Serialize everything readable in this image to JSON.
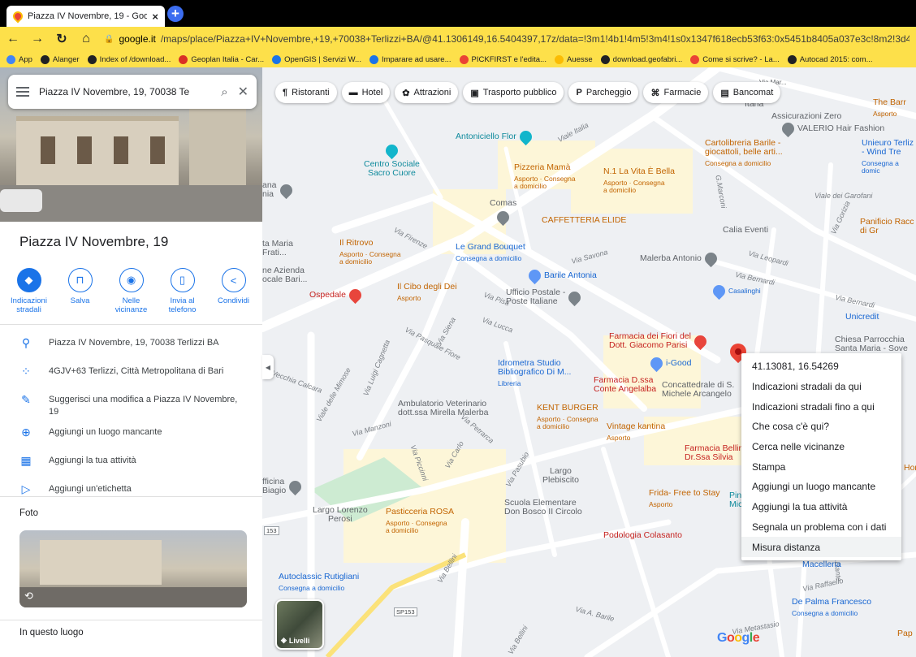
{
  "browser": {
    "tab_title": "Piazza IV Novembre, 19 - Google",
    "tab_close": "×",
    "new_tab": "+",
    "url_host": "google.it",
    "url_rest": "/maps/place/Piazza+IV+Novembre,+19,+70038+Terlizzi+BA/@41.1306149,16.5404397,17z/data=!3m1!4b1!4m5!3m4!1s0x1347f618ecb53f63:0x5451b8405a037e3c!8m2!3d41.1306109!4d16.5426284",
    "bookmarks": [
      {
        "label": "App",
        "color": "#4285f4"
      },
      {
        "label": "Alanger",
        "color": "#202124"
      },
      {
        "label": "Index of /download...",
        "color": "#202124"
      },
      {
        "label": "Geoplan Italia - Car...",
        "color": "#d93025"
      },
      {
        "label": "OpenGIS | Servizi W...",
        "color": "#1a73e8"
      },
      {
        "label": "Imparare ad usare...",
        "color": "#1a73e8"
      },
      {
        "label": "PICKFIRST e l'edita...",
        "color": "#ea4335"
      },
      {
        "label": "Auesse",
        "color": "#fbbc04"
      },
      {
        "label": "download.geofabri...",
        "color": "#202124"
      },
      {
        "label": "Come si scrive? - La...",
        "color": "#ea4335"
      },
      {
        "label": "Autocad 2015: com...",
        "color": "#202124"
      }
    ]
  },
  "panel": {
    "search_value": "Piazza IV Novembre, 19, 70038 Te",
    "place_name": "Piazza IV Novembre, 19",
    "actions": [
      {
        "label": "Indicazioni stradali",
        "icon": "◆"
      },
      {
        "label": "Salva",
        "icon": "⊓"
      },
      {
        "label": "Nelle vicinanze",
        "icon": "◉"
      },
      {
        "label": "Invia al telefono",
        "icon": "▯"
      },
      {
        "label": "Condividi",
        "icon": "<"
      }
    ],
    "info": [
      {
        "icon": "⚲",
        "text": "Piazza IV Novembre, 19, 70038 Terlizzi BA"
      },
      {
        "icon": "⁘",
        "text": "4GJV+63 Terlizzi, Città Metropolitana di Bari"
      },
      {
        "icon": "✎",
        "text": "Suggerisci una modifica a Piazza IV Novembre, 19"
      },
      {
        "icon": "⊕",
        "text": "Aggiungi un luogo mancante"
      },
      {
        "icon": "▦",
        "text": "Aggiungi la tua attività"
      },
      {
        "icon": "▷",
        "text": "Aggiungi un'etichetta"
      }
    ],
    "foto_heading": "Foto",
    "in_questo_luogo": "In questo luogo"
  },
  "map": {
    "chips": [
      {
        "label": "Ristoranti",
        "icon": "¶"
      },
      {
        "label": "Hotel",
        "icon": "▬"
      },
      {
        "label": "Attrazioni",
        "icon": "✿"
      },
      {
        "label": "Trasporto pubblico",
        "icon": "▣"
      },
      {
        "label": "Parcheggio",
        "icon": "P"
      },
      {
        "label": "Farmacie",
        "icon": "⌘"
      },
      {
        "label": "Bancomat",
        "icon": "▤"
      }
    ],
    "pois": {
      "antoniciello": "Antoniciello Flor",
      "centro_sociale": "Centro Sociale\nSacro Cuore",
      "pizzeria": "Pizzeria Mamà",
      "pizzeria_sub": "Asporto · Consegna\na domicilio",
      "la_vita": "N.1 La Vita È Bella",
      "la_vita_sub": "Asporto · Consegna\na domicilio",
      "cartolibreria": "Cartolibreria Barile -\ngiocattoli, belle arti...",
      "cartolibreria_sub": "Consegna a domicilio",
      "assicurazioni": "Assicurazioni Zero",
      "valerio": "VALERIO Hair Fashion",
      "the_barr": "The Barr",
      "the_barr_sub": "Asporto",
      "unieuro": "Unieuro Terliz\n- Wind Tre",
      "unieuro_sub": "Consegna a domic",
      "comas": "Comas",
      "caffetteria": "CAFFETTERIA ELIDE",
      "calia": "Calia Eventi",
      "panificio": "Panificio Racc\ndi Gr",
      "il_ritrovo": "Il Ritrovo",
      "il_ritrovo_sub": "Asporto · Consegna\na domicilio",
      "grand_bouquet": "Le Grand Bouquet",
      "grand_bouquet_sub": "Consegna a domicilio",
      "malerba": "Malerba Antonio",
      "barile_antonia": "Barile Antonia",
      "il_cibo": "Il Cibo degli Dei",
      "il_cibo_sub": "Asporto",
      "ospedale": "Ospedale",
      "ufficio_postale": "Ufficio Postale -\nPoste Italiane",
      "farmacia_fiori": "Farmacia dei Fiori del\nDott. Giacomo Parisi",
      "i_good": "i-Good",
      "idrometra": "Idrometra Studio\nBibliografico Di M...",
      "idrometra_sub": "Libreria",
      "farmacia_dssa": "Farmacia D.ssa\nConte Angelalba",
      "concattedrale": "Concattedrale di S.\nMichele Arcangelo",
      "chiesa": "Chiesa Parrocchia\nSanta Maria - Sove",
      "unicredit": "Unicredit",
      "ambulatorio": "Ambulatorio Veterinario\ndott.ssa Mirella Malerba",
      "kent_burger": "KENT BURGER",
      "kent_burger_sub": "Asporto · Consegna\na domicilio",
      "vintage": "Vintage kantina",
      "vintage_sub": "Asporto",
      "farmacia_bellino": "Farmacia Bellino\nDr.Ssa Silvia",
      "largo_plebiscito": "Largo\nPlebiscito",
      "frida": "Frida- Free to Stay",
      "frida_sub": "Asporto",
      "scuola": "Scuola Elementare\nDon Bosco II Circolo",
      "largo_lorenzo": "Largo Lorenzo\nPerosi",
      "pasticceria": "Pasticceria ROSA",
      "pasticceria_sub": "Asporto · Consegna\na domicilio",
      "podologia": "Podologia Colasanto",
      "autoclassic": "Autoclassic Rutigliani",
      "autoclassic_sub": "Consegna a domicilio",
      "de_palma": "De Palma Francesco",
      "de_palma_sub": "Consegna a domicilio",
      "macelleria": "Macelleria",
      "officina": "fficina\nBiagio",
      "tta_maria": "ta Maria\nFrati...",
      "azienda": "ne Azienda\nocale Bari...",
      "ana": "ana\nnia",
      "hor": "Hor",
      "pap": "Pap",
      "pin_frag": "Pin\nMic",
      "italia_frag": "Itana",
      "via_mar_frag": "Via Mar...",
      "casalinghi": "Casalinghi"
    },
    "streets": {
      "viale_italia": "Viale Italia",
      "via_firenze": "Via Firenze",
      "via_savona": "Via Savona",
      "via_leopardi": "Via Leopardi",
      "via_bernardi": "Via Bernardi",
      "via_bernardi2": "Via Bernardi",
      "via_pisa": "Via Pisa",
      "via_lucca": "Via Lucca",
      "via_siena": "Via Siena",
      "via_pasquale_fiore": "Via Pasquale Fiore",
      "viale_mimose": "Viale delle Mimose",
      "via_luigi_cagnetta": "Via Luigi Cagnetta",
      "via_calcara": "Vecchia Calcara",
      "via_manzoni": "Via Manzoni",
      "via_petrarca": "Via Petrarca",
      "via_carlo": "Via Carlo",
      "via_piccinni": "Via Piccinni",
      "via_pasubio": "Via Pasubio",
      "via_bellini": "Via Bellini",
      "via_bellini2": "Via Bellini",
      "via_a_barile": "Via A. Barile",
      "viale_garofani": "Viale dei Garofani",
      "via_gorizia": "Via Gorizia",
      "vico_d_ante": "Vico 4 Dante",
      "via_raffaello": "Via Raffaello",
      "via_metastasio": "Via Metastasio",
      "via_marconi": "G.Marconi",
      "sp153": "SP153",
      "r153": "153"
    },
    "context_menu": [
      "41.13081, 16.54269",
      "Indicazioni stradali da qui",
      "Indicazioni stradali fino a qui",
      "Che cosa c'è qui?",
      "Cerca nelle vicinanze",
      "Stampa",
      "Aggiungi un luogo mancante",
      "Aggiungi la tua attività",
      "Segnala un problema con i dati",
      "Misura distanza"
    ],
    "layers_label": "Livelli",
    "google_logo": "Google"
  }
}
